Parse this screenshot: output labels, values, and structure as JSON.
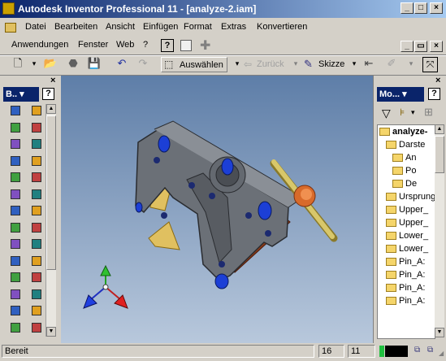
{
  "window": {
    "title": "Autodesk Inventor Professional 11 - [analyze-2.iam]",
    "min": "_",
    "max": "□",
    "close": "×"
  },
  "menu1": [
    "Datei",
    "Bearbeiten",
    "Ansicht",
    "Einfügen",
    "Format",
    "Extras",
    "Konvertieren"
  ],
  "menu2": [
    "Anwendungen",
    "Fenster",
    "Web",
    "?"
  ],
  "toolbar": {
    "select_label": "Auswählen",
    "back_label": "Zurück",
    "sketch_label": "Skizze"
  },
  "left_panel": {
    "title": "B..",
    "help": "?",
    "close": "×"
  },
  "browser": {
    "title": "Mo...",
    "help": "?",
    "close": "×",
    "items": [
      {
        "label": "analyze-",
        "depth": 0,
        "bold": true
      },
      {
        "label": "Darste",
        "depth": 1
      },
      {
        "label": "An",
        "depth": 2
      },
      {
        "label": "Po",
        "depth": 2
      },
      {
        "label": "De",
        "depth": 2
      },
      {
        "label": "Ursprung",
        "depth": 1
      },
      {
        "label": "Upper_",
        "depth": 1
      },
      {
        "label": "Upper_",
        "depth": 1
      },
      {
        "label": "Lower_",
        "depth": 1
      },
      {
        "label": "Lower_",
        "depth": 1
      },
      {
        "label": "Pin_A:",
        "depth": 1
      },
      {
        "label": "Pin_A:",
        "depth": 1
      },
      {
        "label": "Pin_A:",
        "depth": 1
      },
      {
        "label": "Pin_A:",
        "depth": 1
      }
    ]
  },
  "status": {
    "text": "Bereit",
    "field1": "16",
    "field2": "11"
  },
  "colors": {
    "title_start": "#0a246a",
    "title_end": "#a6caf0",
    "viewport_top": "#5e7ea8",
    "viewport_bottom": "#b8c8dc",
    "part_gray": "#6b7077",
    "accent_blue": "#1c3fd6",
    "handle_gold": "#d8c76a",
    "knob_orange": "#d86a2a"
  }
}
